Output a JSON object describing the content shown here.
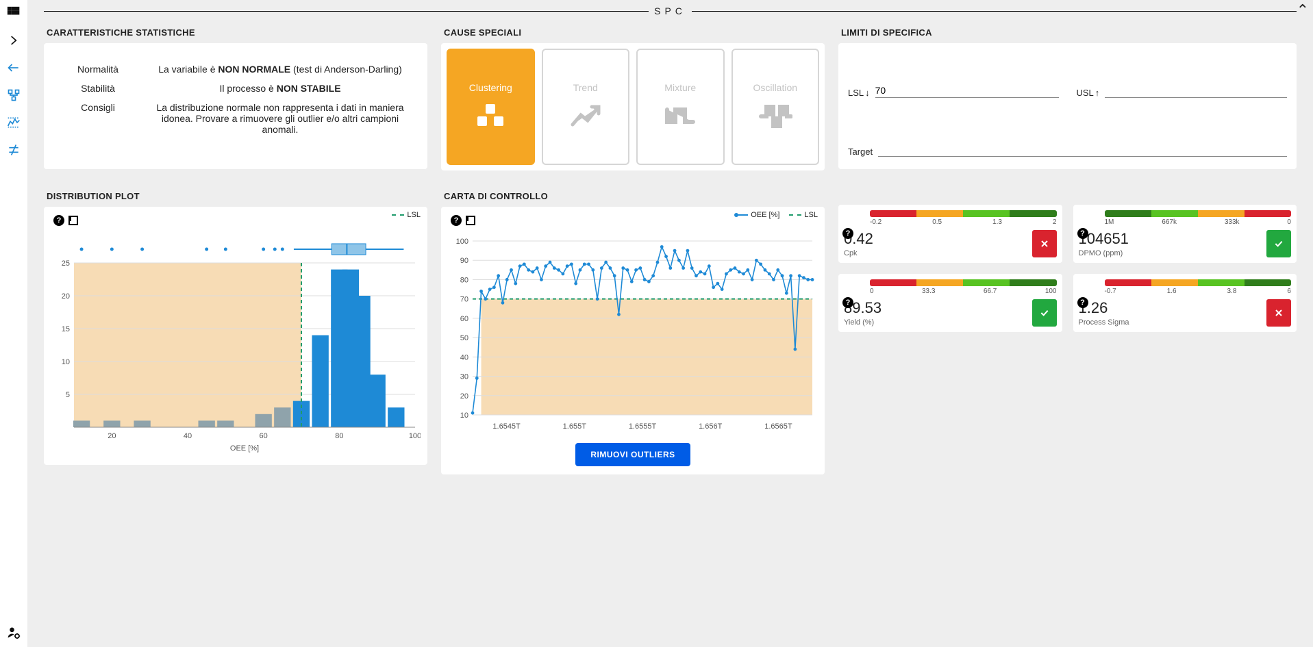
{
  "page": {
    "title": "SPC"
  },
  "rail": {
    "icons": [
      "apps",
      "chevron-right",
      "arrow-left",
      "node-tree",
      "control-chart",
      "not-equal",
      "user-cog"
    ]
  },
  "stats": {
    "heading": "CARATTERISTICHE STATISTICHE",
    "rows": [
      {
        "label": "Normalità",
        "prefix": "La variabile è ",
        "bold": "NON NORMALE",
        "suffix": " (test di Anderson-Darling)"
      },
      {
        "label": "Stabilità",
        "prefix": "Il processo è ",
        "bold": "NON STABILE",
        "suffix": ""
      },
      {
        "label": "Consigli",
        "prefix": "La distribuzione normale non rappresenta i dati in maniera idonea. Provare a rimuovere gli outlier e/o altri campioni anomali.",
        "bold": "",
        "suffix": ""
      }
    ]
  },
  "causes": {
    "heading": "CAUSE SPECIALI",
    "items": [
      {
        "label": "Clustering",
        "active": true,
        "icon": "cluster"
      },
      {
        "label": "Trend",
        "active": false,
        "icon": "trend"
      },
      {
        "label": "Mixture",
        "active": false,
        "icon": "mixture"
      },
      {
        "label": "Oscillation",
        "active": false,
        "icon": "oscillation"
      }
    ]
  },
  "spec": {
    "heading": "LIMITI DI SPECIFICA",
    "lsl": {
      "label": "LSL",
      "icon": "↓",
      "value": "70"
    },
    "usl": {
      "label": "USL",
      "icon": "↑",
      "value": ""
    },
    "target": {
      "label": "Target",
      "value": ""
    }
  },
  "dist": {
    "heading": "DISTRIBUTION PLOT",
    "legend_lsl": "LSL"
  },
  "control": {
    "heading": "CARTA DI CONTROLLO",
    "legend_series": "OEE [%]",
    "legend_lsl": "LSL",
    "button": "RIMUOVI OUTLIERS"
  },
  "kpi": [
    {
      "name": "Cpk",
      "value": "0.42",
      "status": "bad",
      "scale": {
        "colors": [
          "#d9232e",
          "#f5a623",
          "#58c322",
          "#2f7d1b"
        ],
        "labels": [
          "-0.2",
          "0.5",
          "1.3",
          "2"
        ]
      }
    },
    {
      "name": "DPMO (ppm)",
      "value": "104651",
      "status": "ok",
      "scale": {
        "colors": [
          "#2f7d1b",
          "#58c322",
          "#f5a623",
          "#d9232e"
        ],
        "labels": [
          "1M",
          "667k",
          "333k",
          "0"
        ]
      }
    },
    {
      "name": "Yield (%)",
      "value": "89.53",
      "status": "ok",
      "scale": {
        "colors": [
          "#d9232e",
          "#f5a623",
          "#58c322",
          "#2f7d1b"
        ],
        "labels": [
          "0",
          "33.3",
          "66.7",
          "100"
        ]
      }
    },
    {
      "name": "Process Sigma",
      "value": "1.26",
      "status": "bad",
      "scale": {
        "colors": [
          "#d9232e",
          "#f5a623",
          "#58c322",
          "#2f7d1b"
        ],
        "labels": [
          "-0.7",
          "1.6",
          "3.8",
          "6"
        ]
      }
    }
  ],
  "chart_data": [
    {
      "type": "bar",
      "id": "distribution",
      "title": "DISTRIBUTION PLOT",
      "xlabel": "OEE [%]",
      "ylabel": "",
      "xlim": [
        10,
        100
      ],
      "ylim": [
        0,
        25
      ],
      "xticks": [
        20,
        40,
        60,
        80,
        100
      ],
      "yticks": [
        5,
        10,
        15,
        20,
        25
      ],
      "lsl": 70,
      "bins": [
        {
          "x": 12,
          "y": 1,
          "below": true
        },
        {
          "x": 20,
          "y": 1,
          "below": true
        },
        {
          "x": 28,
          "y": 1,
          "below": true
        },
        {
          "x": 45,
          "y": 1,
          "below": true
        },
        {
          "x": 50,
          "y": 1,
          "below": true
        },
        {
          "x": 60,
          "y": 2,
          "below": true
        },
        {
          "x": 65,
          "y": 3,
          "below": true
        },
        {
          "x": 70,
          "y": 4,
          "below": false
        },
        {
          "x": 75,
          "y": 14,
          "below": false
        },
        {
          "x": 80,
          "y": 24,
          "below": false
        },
        {
          "x": 83,
          "y": 24,
          "below": false
        },
        {
          "x": 86,
          "y": 20,
          "below": false
        },
        {
          "x": 90,
          "y": 8,
          "below": false
        },
        {
          "x": 95,
          "y": 3,
          "below": false
        }
      ],
      "boxplot": {
        "min": 68,
        "q1": 78,
        "median": 82,
        "q3": 87,
        "max": 97,
        "outliers": [
          12,
          20,
          28,
          45,
          50,
          60,
          63,
          65
        ]
      }
    },
    {
      "type": "line",
      "id": "control-chart",
      "title": "CARTA DI CONTROLLO",
      "xlabel": "",
      "ylabel": "",
      "xlim": [
        1.6543,
        1.6568
      ],
      "ylim": [
        10,
        100
      ],
      "xticks": [
        "1.6545T",
        "1.655T",
        "1.6555T",
        "1.656T",
        "1.6565T"
      ],
      "yticks": [
        10,
        20,
        30,
        40,
        50,
        60,
        70,
        80,
        90,
        100
      ],
      "lsl": 70,
      "series": [
        {
          "name": "OEE [%]",
          "values": [
            11,
            29,
            74,
            70,
            75,
            76,
            82,
            68,
            80,
            85,
            78,
            87,
            88,
            85,
            84,
            86,
            80,
            87,
            89,
            86,
            85,
            83,
            87,
            88,
            78,
            85,
            88,
            88,
            85,
            70,
            86,
            89,
            86,
            82,
            62,
            86,
            85,
            79,
            85,
            86,
            80,
            79,
            82,
            89,
            97,
            92,
            86,
            95,
            90,
            86,
            95,
            86,
            82,
            84,
            83,
            87,
            76,
            78,
            75,
            83,
            85,
            86,
            84,
            83,
            85,
            80,
            90,
            88,
            85,
            83,
            80,
            85,
            82,
            73,
            82,
            44,
            82,
            81,
            80,
            80
          ]
        }
      ]
    }
  ]
}
